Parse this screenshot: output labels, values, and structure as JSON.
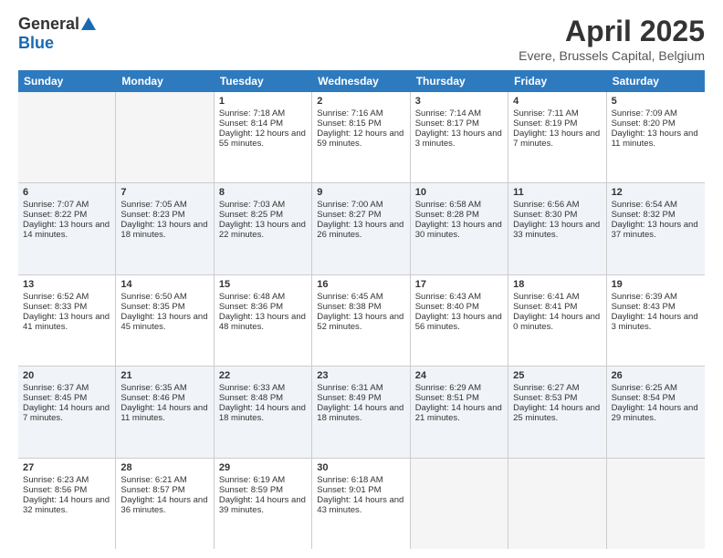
{
  "logo": {
    "general": "General",
    "blue": "Blue"
  },
  "title": {
    "month": "April 2025",
    "location": "Evere, Brussels Capital, Belgium"
  },
  "weekdays": [
    "Sunday",
    "Monday",
    "Tuesday",
    "Wednesday",
    "Thursday",
    "Friday",
    "Saturday"
  ],
  "weeks": [
    [
      {
        "day": "",
        "empty": true
      },
      {
        "day": "",
        "empty": true
      },
      {
        "day": "1",
        "sunrise": "Sunrise: 7:18 AM",
        "sunset": "Sunset: 8:14 PM",
        "daylight": "Daylight: 12 hours and 55 minutes."
      },
      {
        "day": "2",
        "sunrise": "Sunrise: 7:16 AM",
        "sunset": "Sunset: 8:15 PM",
        "daylight": "Daylight: 12 hours and 59 minutes."
      },
      {
        "day": "3",
        "sunrise": "Sunrise: 7:14 AM",
        "sunset": "Sunset: 8:17 PM",
        "daylight": "Daylight: 13 hours and 3 minutes."
      },
      {
        "day": "4",
        "sunrise": "Sunrise: 7:11 AM",
        "sunset": "Sunset: 8:19 PM",
        "daylight": "Daylight: 13 hours and 7 minutes."
      },
      {
        "day": "5",
        "sunrise": "Sunrise: 7:09 AM",
        "sunset": "Sunset: 8:20 PM",
        "daylight": "Daylight: 13 hours and 11 minutes."
      }
    ],
    [
      {
        "day": "6",
        "sunrise": "Sunrise: 7:07 AM",
        "sunset": "Sunset: 8:22 PM",
        "daylight": "Daylight: 13 hours and 14 minutes."
      },
      {
        "day": "7",
        "sunrise": "Sunrise: 7:05 AM",
        "sunset": "Sunset: 8:23 PM",
        "daylight": "Daylight: 13 hours and 18 minutes."
      },
      {
        "day": "8",
        "sunrise": "Sunrise: 7:03 AM",
        "sunset": "Sunset: 8:25 PM",
        "daylight": "Daylight: 13 hours and 22 minutes."
      },
      {
        "day": "9",
        "sunrise": "Sunrise: 7:00 AM",
        "sunset": "Sunset: 8:27 PM",
        "daylight": "Daylight: 13 hours and 26 minutes."
      },
      {
        "day": "10",
        "sunrise": "Sunrise: 6:58 AM",
        "sunset": "Sunset: 8:28 PM",
        "daylight": "Daylight: 13 hours and 30 minutes."
      },
      {
        "day": "11",
        "sunrise": "Sunrise: 6:56 AM",
        "sunset": "Sunset: 8:30 PM",
        "daylight": "Daylight: 13 hours and 33 minutes."
      },
      {
        "day": "12",
        "sunrise": "Sunrise: 6:54 AM",
        "sunset": "Sunset: 8:32 PM",
        "daylight": "Daylight: 13 hours and 37 minutes."
      }
    ],
    [
      {
        "day": "13",
        "sunrise": "Sunrise: 6:52 AM",
        "sunset": "Sunset: 8:33 PM",
        "daylight": "Daylight: 13 hours and 41 minutes."
      },
      {
        "day": "14",
        "sunrise": "Sunrise: 6:50 AM",
        "sunset": "Sunset: 8:35 PM",
        "daylight": "Daylight: 13 hours and 45 minutes."
      },
      {
        "day": "15",
        "sunrise": "Sunrise: 6:48 AM",
        "sunset": "Sunset: 8:36 PM",
        "daylight": "Daylight: 13 hours and 48 minutes."
      },
      {
        "day": "16",
        "sunrise": "Sunrise: 6:45 AM",
        "sunset": "Sunset: 8:38 PM",
        "daylight": "Daylight: 13 hours and 52 minutes."
      },
      {
        "day": "17",
        "sunrise": "Sunrise: 6:43 AM",
        "sunset": "Sunset: 8:40 PM",
        "daylight": "Daylight: 13 hours and 56 minutes."
      },
      {
        "day": "18",
        "sunrise": "Sunrise: 6:41 AM",
        "sunset": "Sunset: 8:41 PM",
        "daylight": "Daylight: 14 hours and 0 minutes."
      },
      {
        "day": "19",
        "sunrise": "Sunrise: 6:39 AM",
        "sunset": "Sunset: 8:43 PM",
        "daylight": "Daylight: 14 hours and 3 minutes."
      }
    ],
    [
      {
        "day": "20",
        "sunrise": "Sunrise: 6:37 AM",
        "sunset": "Sunset: 8:45 PM",
        "daylight": "Daylight: 14 hours and 7 minutes."
      },
      {
        "day": "21",
        "sunrise": "Sunrise: 6:35 AM",
        "sunset": "Sunset: 8:46 PM",
        "daylight": "Daylight: 14 hours and 11 minutes."
      },
      {
        "day": "22",
        "sunrise": "Sunrise: 6:33 AM",
        "sunset": "Sunset: 8:48 PM",
        "daylight": "Daylight: 14 hours and 18 minutes."
      },
      {
        "day": "23",
        "sunrise": "Sunrise: 6:31 AM",
        "sunset": "Sunset: 8:49 PM",
        "daylight": "Daylight: 14 hours and 18 minutes."
      },
      {
        "day": "24",
        "sunrise": "Sunrise: 6:29 AM",
        "sunset": "Sunset: 8:51 PM",
        "daylight": "Daylight: 14 hours and 21 minutes."
      },
      {
        "day": "25",
        "sunrise": "Sunrise: 6:27 AM",
        "sunset": "Sunset: 8:53 PM",
        "daylight": "Daylight: 14 hours and 25 minutes."
      },
      {
        "day": "26",
        "sunrise": "Sunrise: 6:25 AM",
        "sunset": "Sunset: 8:54 PM",
        "daylight": "Daylight: 14 hours and 29 minutes."
      }
    ],
    [
      {
        "day": "27",
        "sunrise": "Sunrise: 6:23 AM",
        "sunset": "Sunset: 8:56 PM",
        "daylight": "Daylight: 14 hours and 32 minutes."
      },
      {
        "day": "28",
        "sunrise": "Sunrise: 6:21 AM",
        "sunset": "Sunset: 8:57 PM",
        "daylight": "Daylight: 14 hours and 36 minutes."
      },
      {
        "day": "29",
        "sunrise": "Sunrise: 6:19 AM",
        "sunset": "Sunset: 8:59 PM",
        "daylight": "Daylight: 14 hours and 39 minutes."
      },
      {
        "day": "30",
        "sunrise": "Sunrise: 6:18 AM",
        "sunset": "Sunset: 9:01 PM",
        "daylight": "Daylight: 14 hours and 43 minutes."
      },
      {
        "day": "",
        "empty": true
      },
      {
        "day": "",
        "empty": true
      },
      {
        "day": "",
        "empty": true
      }
    ]
  ]
}
